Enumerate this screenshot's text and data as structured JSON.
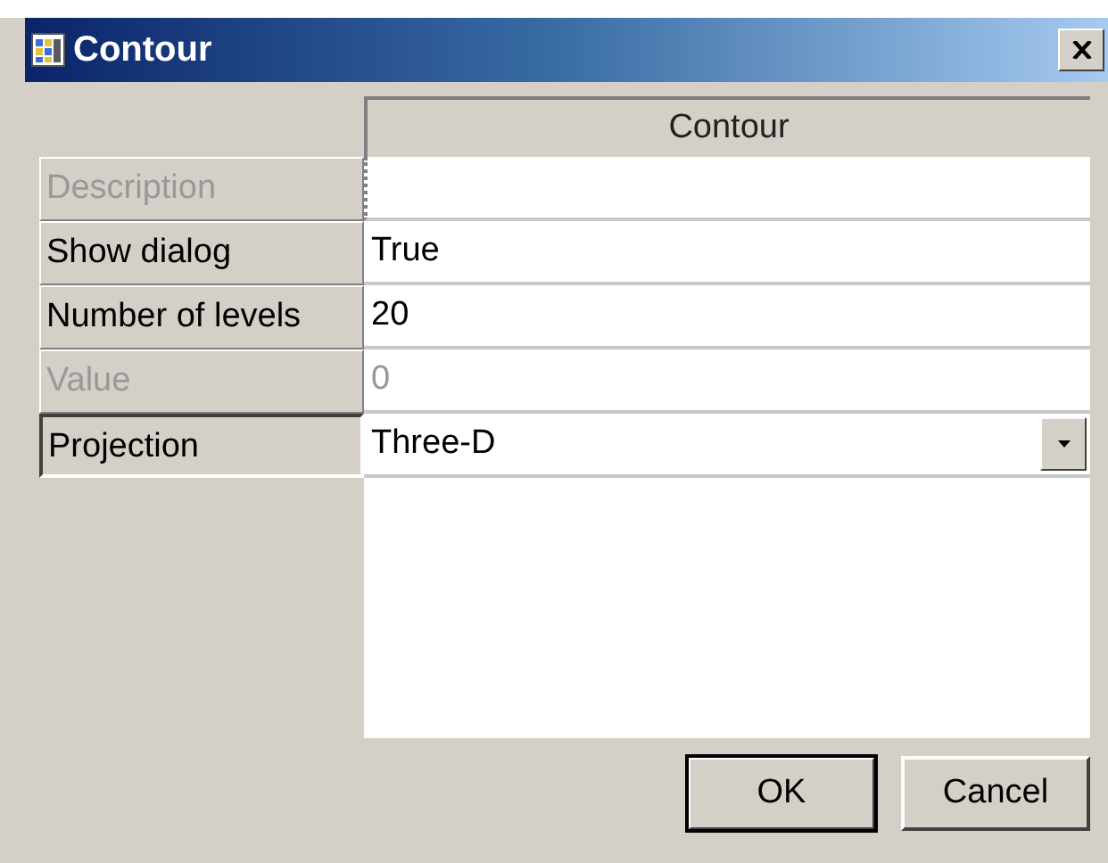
{
  "window": {
    "title": "Contour"
  },
  "grid": {
    "column_header": "Contour",
    "rows": [
      {
        "label": "Description",
        "value": "",
        "disabled": true,
        "selected": false,
        "kind": "text"
      },
      {
        "label": "Show dialog",
        "value": "True",
        "disabled": false,
        "selected": false,
        "kind": "text"
      },
      {
        "label": "Number of levels",
        "value": "20",
        "disabled": false,
        "selected": false,
        "kind": "text"
      },
      {
        "label": "Value",
        "value": "0",
        "disabled": true,
        "selected": false,
        "kind": "text"
      },
      {
        "label": "Projection",
        "value": "Three-D",
        "disabled": false,
        "selected": true,
        "kind": "dropdown"
      }
    ]
  },
  "buttons": [
    {
      "label": "OK",
      "default": true
    },
    {
      "label": "Cancel",
      "default": false
    }
  ]
}
